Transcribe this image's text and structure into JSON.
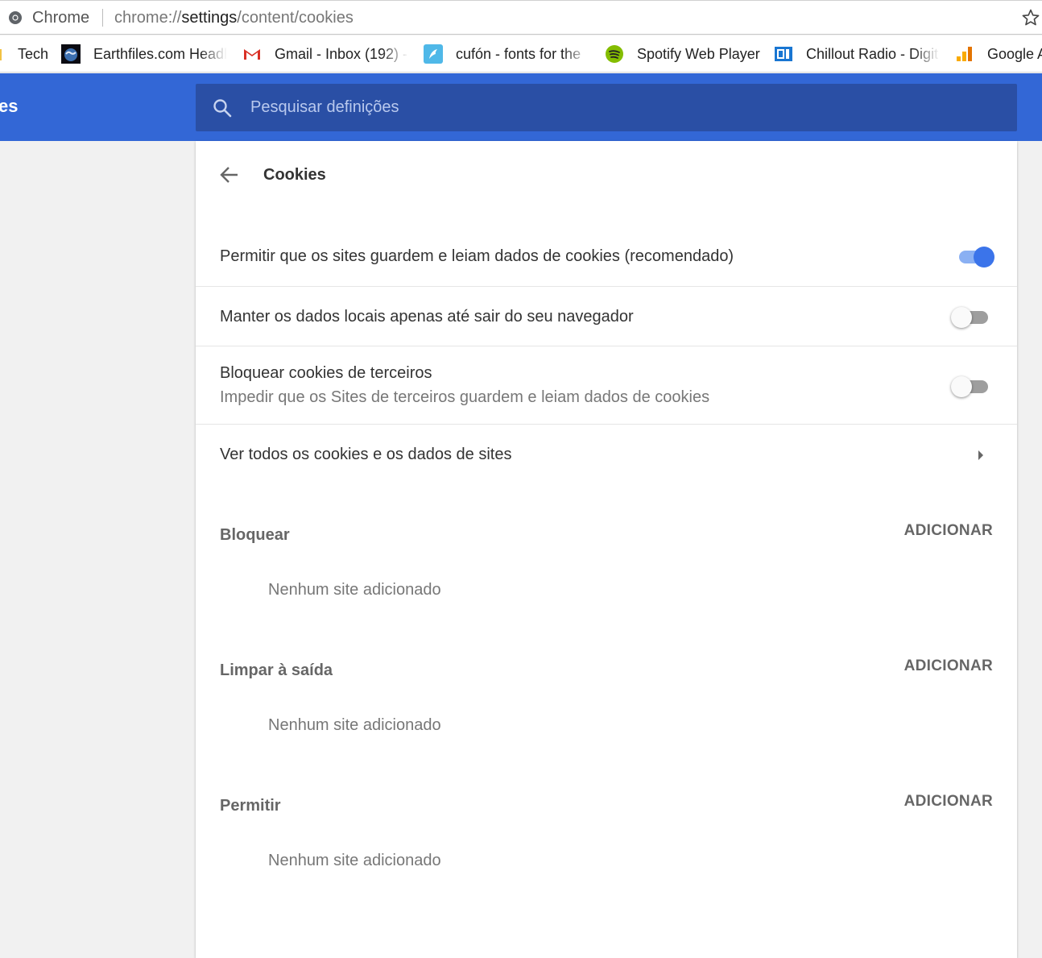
{
  "browser": {
    "name": "Chrome",
    "url_prefix": "chrome://",
    "url_host": "settings",
    "url_path": "/content/cookies"
  },
  "bookmarks": [
    {
      "label": "Tech",
      "icon": "folder-icon"
    },
    {
      "label": "Earthfiles.com Headl",
      "icon": "earthfiles-icon"
    },
    {
      "label": "Gmail - Inbox (192) -",
      "icon": "gmail-icon"
    },
    {
      "label": "cufón - fonts for the",
      "icon": "cufon-icon"
    },
    {
      "label": "Spotify Web Player",
      "icon": "spotify-icon"
    },
    {
      "label": "Chillout Radio - Digit",
      "icon": "di-radio-icon"
    },
    {
      "label": "Google A",
      "icon": "google-analytics-icon"
    }
  ],
  "header": {
    "title": "es",
    "search_placeholder": "Pesquisar definições"
  },
  "page": {
    "title": "Cookies",
    "settings": [
      {
        "label": "Permitir que os sites guardem e leiam dados de cookies (recomendado)",
        "enabled": true
      },
      {
        "label": "Manter os dados locais apenas até sair do seu navegador",
        "enabled": false
      },
      {
        "label": "Bloquear cookies de terceiros",
        "sublabel": "Impedir que os Sites de terceiros guardem e leiam dados de cookies",
        "enabled": false
      }
    ],
    "view_all_label": "Ver todos os cookies e os dados de sites",
    "sections": [
      {
        "title": "Bloquear",
        "add_label": "ADICIONAR",
        "empty_text": "Nenhum site adicionado"
      },
      {
        "title": "Limpar à saída",
        "add_label": "ADICIONAR",
        "empty_text": "Nenhum site adicionado"
      },
      {
        "title": "Permitir",
        "add_label": "ADICIONAR",
        "empty_text": "Nenhum site adicionado"
      }
    ]
  },
  "colors": {
    "header_blue": "#3367d6",
    "search_blue": "#2a4fa5",
    "toggle_on": "#3b74ea"
  }
}
